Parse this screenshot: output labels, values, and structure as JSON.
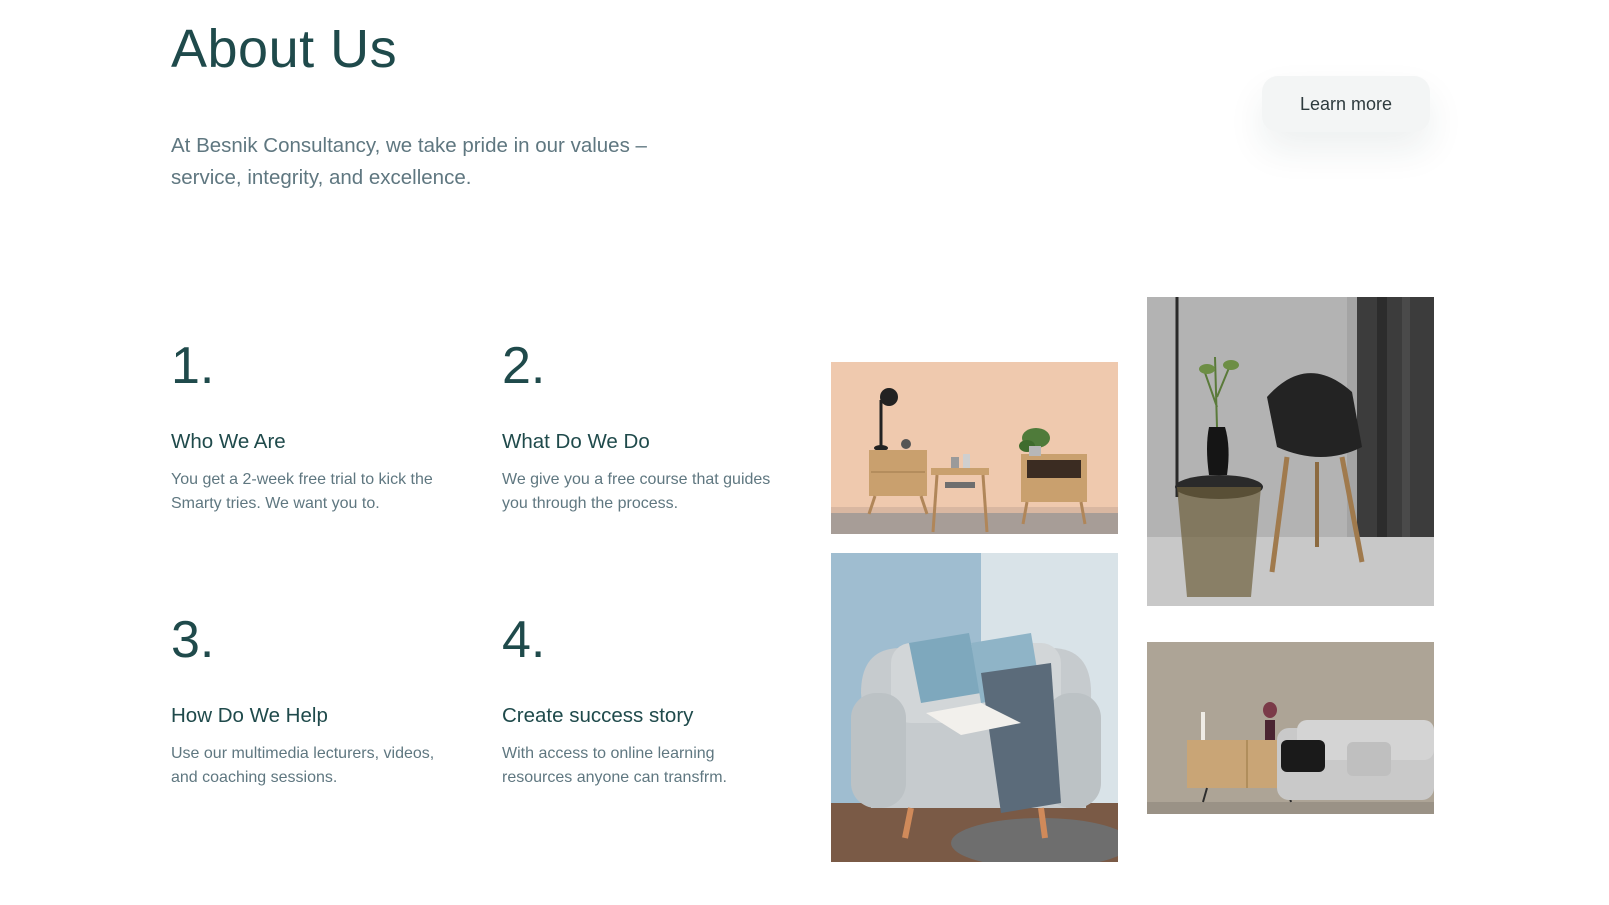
{
  "header": {
    "title": "About Us",
    "intro": "At Besnik Consultancy, we take pride in our values – service, integrity, and excellence.",
    "learn_more_label": "Learn more"
  },
  "steps": [
    {
      "number": "1.",
      "title": "Who We Are",
      "text": "You get a 2-week free trial to kick the Smarty tries. We want you to."
    },
    {
      "number": "2.",
      "title": "What Do We Do",
      "text": "We give you a free course that guides you through the process."
    },
    {
      "number": "3.",
      "title": "How Do We Help",
      "text": "Use our multimedia lecturers, videos, and coaching sessions."
    },
    {
      "number": "4.",
      "title": "Create success story",
      "text": "With access to online learning resources anyone can transfrm."
    }
  ],
  "photos": [
    "side-tables-photo",
    "black-chair-photo",
    "armchair-photo",
    "sofa-photo"
  ],
  "colors": {
    "heading": "#1f4a4b",
    "body_text": "#5f7780",
    "button_bg": "#f3f5f5"
  }
}
